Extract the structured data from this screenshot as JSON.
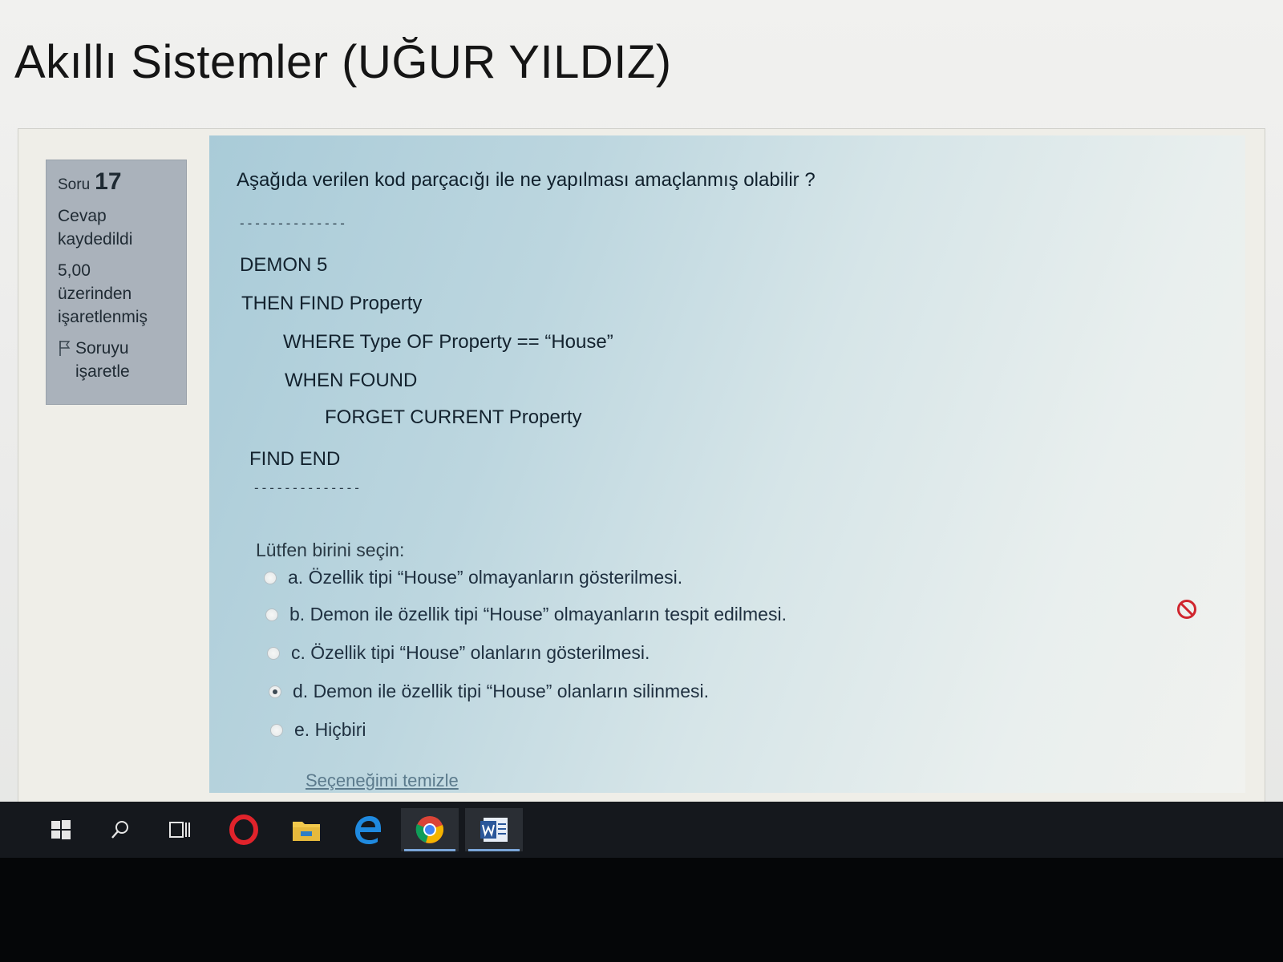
{
  "page": {
    "title": "Akıllı Sistemler (UĞUR YILDIZ)"
  },
  "info": {
    "question_label": "Soru",
    "question_number": "17",
    "status_line1": "Cevap",
    "status_line2": "kaydedildi",
    "mark_line1": "5,00",
    "mark_line2": "üzerinden",
    "mark_line3": "işaretlenmiş",
    "flag_line1": "Soruyu",
    "flag_line2": "işaretle",
    "flag_icon": "flag-icon"
  },
  "question": {
    "text": "Aşağıda verilen kod parçacığı ile ne yapılması amaçlanmış olabilir ?",
    "divider_top": "--------------",
    "code": [
      "DEMON 5",
      "THEN FIND Property",
      "WHERE Type OF Property == “House”",
      "WHEN FOUND",
      "FORGET CURRENT Property",
      "FIND END"
    ],
    "divider_bottom": "--------------",
    "choose_label": "Lütfen birini seçin:",
    "options": [
      {
        "label": "a. Özellik tipi “House” olmayanların gösterilmesi.",
        "selected": false
      },
      {
        "label": "b. Demon ile özellik tipi “House” olmayanların tespit edilmesi.",
        "selected": false
      },
      {
        "label": "c. Özellik tipi “House” olanların gösterilmesi.",
        "selected": false
      },
      {
        "label": "d. Demon ile özellik tipi “House” olanların silinmesi.",
        "selected": true
      },
      {
        "label": "e. Hiçbiri",
        "selected": false
      }
    ],
    "clear_label": "Seçeneğimi temizle",
    "result_icon": "incorrect-icon",
    "result_color": "#d0262e"
  },
  "taskbar": {
    "items": [
      "windows-start-icon",
      "search-icon",
      "task-view-icon",
      "opera-icon",
      "file-explorer-icon",
      "edge-icon",
      "chrome-icon",
      "word-icon"
    ]
  }
}
